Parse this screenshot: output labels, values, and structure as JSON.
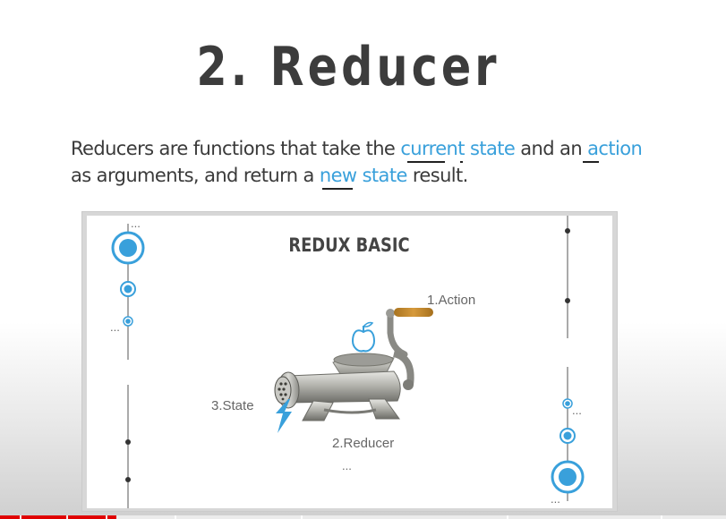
{
  "slide": {
    "title": "2. Reducer",
    "description": {
      "part1": "Reducers are functions that take the ",
      "hl1": "current state",
      "part2": " and an ",
      "hl2": "action",
      "part3": "as arguments, and return a ",
      "hl3": "new state",
      "part4": " result."
    },
    "highlight_color": "#39a0db"
  },
  "diagram": {
    "title": "REDUX BASIC",
    "label_action": "1.Action",
    "label_reducer": "2.Reducer",
    "label_state": "3.State",
    "ellipsis": "..."
  },
  "icons": [
    "apple-icon",
    "meat-grinder-illustration",
    "lightning-bolt-icon",
    "concentric-circle-icon",
    "dot-icon"
  ],
  "player": {
    "progress": 0.16,
    "progress_color": "#e00000"
  }
}
